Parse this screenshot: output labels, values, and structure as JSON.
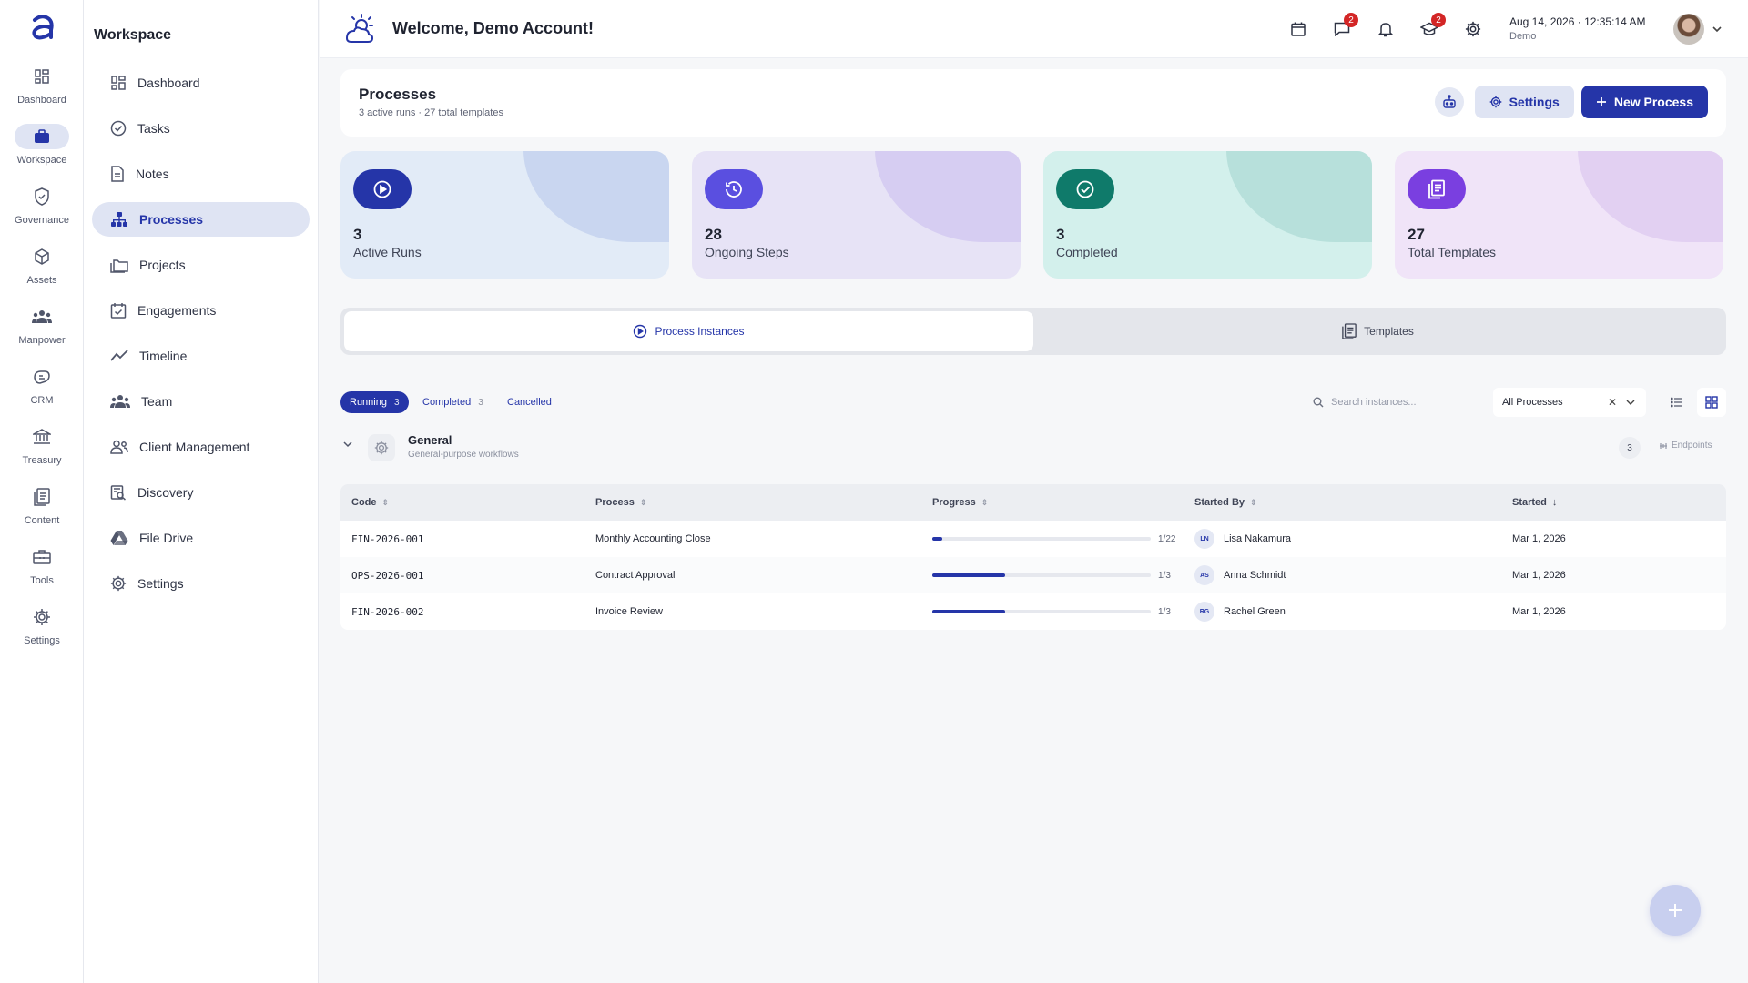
{
  "rail": {
    "items": [
      {
        "label": "Dashboard",
        "icon": "dashboard-icon"
      },
      {
        "label": "Workspace",
        "icon": "briefcase-icon"
      },
      {
        "label": "Governance",
        "icon": "shield-icon"
      },
      {
        "label": "Assets",
        "icon": "cube-icon"
      },
      {
        "label": "Manpower",
        "icon": "people-icon"
      },
      {
        "label": "CRM",
        "icon": "handshake-icon"
      },
      {
        "label": "Treasury",
        "icon": "bank-icon"
      },
      {
        "label": "Content",
        "icon": "document-icon"
      },
      {
        "label": "Tools",
        "icon": "toolbox-icon"
      },
      {
        "label": "Settings",
        "icon": "gear-icon"
      }
    ]
  },
  "sidebar": {
    "title": "Workspace",
    "items": [
      {
        "label": "Dashboard",
        "icon": "dashboard-icon"
      },
      {
        "label": "Tasks",
        "icon": "check-circle-icon"
      },
      {
        "label": "Notes",
        "icon": "note-icon"
      },
      {
        "label": "Processes",
        "icon": "hierarchy-icon"
      },
      {
        "label": "Projects",
        "icon": "folders-icon"
      },
      {
        "label": "Engagements",
        "icon": "calendar-check-icon"
      },
      {
        "label": "Timeline",
        "icon": "timeline-icon"
      },
      {
        "label": "Team",
        "icon": "team-icon"
      },
      {
        "label": "Client Management",
        "icon": "client-icon"
      },
      {
        "label": "Discovery",
        "icon": "discovery-icon"
      },
      {
        "label": "File Drive",
        "icon": "drive-icon"
      },
      {
        "label": "Settings",
        "icon": "gear-icon"
      }
    ]
  },
  "header": {
    "welcome": "Welcome, Demo Account!",
    "messages_badge": "2",
    "learning_badge": "2",
    "date": "Aug 14, 2026",
    "time": "12:35:14 AM",
    "user": "Demo"
  },
  "page": {
    "title": "Processes",
    "subtitle": "3 active runs · 27 total templates",
    "settings_label": "Settings",
    "new_label": "New Process"
  },
  "stats": [
    {
      "value": "3",
      "label": "Active Runs",
      "bg": "#e2ebf7",
      "blob": "#c9d6f0",
      "icon_bg": "#2535a8"
    },
    {
      "value": "28",
      "label": "Ongoing Steps",
      "bg": "#e7e3f6",
      "blob": "#d6cdf2",
      "icon_bg": "#5a4fe0"
    },
    {
      "value": "3",
      "label": "Completed",
      "bg": "#d3f0ec",
      "blob": "#b7e0db",
      "icon_bg": "#0f7a6a"
    },
    {
      "value": "27",
      "label": "Total Templates",
      "bg": "#f0e4f8",
      "blob": "#e2d0f2",
      "icon_bg": "#7a3fe0"
    }
  ],
  "tabs": [
    {
      "label": "Process Instances"
    },
    {
      "label": "Templates"
    }
  ],
  "filters": {
    "chips": [
      {
        "label": "Running",
        "count": "3"
      },
      {
        "label": "Completed",
        "count": "3"
      },
      {
        "label": "Cancelled",
        "count": ""
      }
    ],
    "search_placeholder": "Search instances...",
    "select_value": "All Processes"
  },
  "group": {
    "name": "General",
    "description": "General-purpose workflows",
    "count": "3",
    "endpoints_label": "Endpoints"
  },
  "table": {
    "columns": [
      "Code",
      "Process",
      "Progress",
      "Started By",
      "Started"
    ],
    "rows": [
      {
        "code": "FIN-2026-001",
        "process": "Monthly Accounting Close",
        "done": 1,
        "total": 22,
        "progress_label": "1/22",
        "initials": "LN",
        "started_by": "Lisa Nakamura",
        "started": "Mar 1, 2026"
      },
      {
        "code": "OPS-2026-001",
        "process": "Contract Approval",
        "done": 1,
        "total": 3,
        "progress_label": "1/3",
        "initials": "AS",
        "started_by": "Anna Schmidt",
        "started": "Mar 1, 2026"
      },
      {
        "code": "FIN-2026-002",
        "process": "Invoice Review",
        "done": 1,
        "total": 3,
        "progress_label": "1/3",
        "initials": "RG",
        "started_by": "Rachel Green",
        "started": "Mar 1, 2026"
      }
    ]
  },
  "colors": {
    "accent": "#2535a8",
    "badge": "#d32626"
  }
}
